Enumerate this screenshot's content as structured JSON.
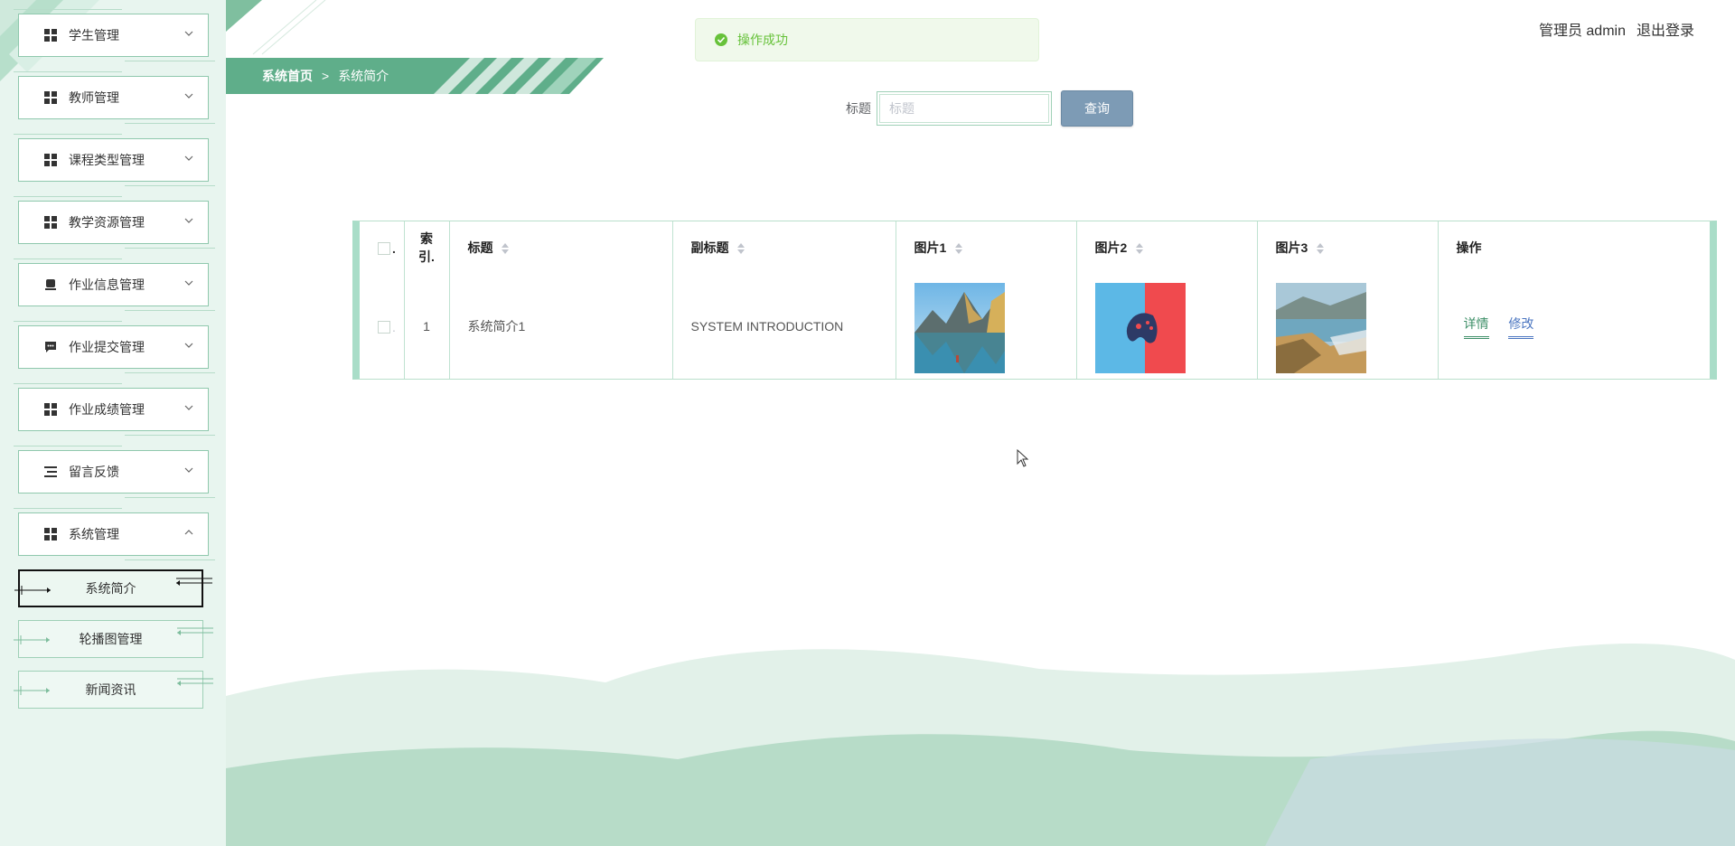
{
  "sidebar": {
    "menus": [
      {
        "label": "学生管理",
        "icon": "grid-icon",
        "expanded": false
      },
      {
        "label": "教师管理",
        "icon": "grid-icon",
        "expanded": false
      },
      {
        "label": "课程类型管理",
        "icon": "grid-icon",
        "expanded": false
      },
      {
        "label": "教学资源管理",
        "icon": "grid-icon",
        "expanded": false
      },
      {
        "label": "作业信息管理",
        "icon": "cup-icon",
        "expanded": false
      },
      {
        "label": "作业提交管理",
        "icon": "chat-icon",
        "expanded": false
      },
      {
        "label": "作业成绩管理",
        "icon": "grid-icon",
        "expanded": false
      },
      {
        "label": "留言反馈",
        "icon": "list-icon",
        "expanded": false
      },
      {
        "label": "系统管理",
        "icon": "grid-icon",
        "expanded": true
      }
    ],
    "submenu": [
      {
        "label": "系统简介",
        "active": true
      },
      {
        "label": "轮播图管理",
        "active": false
      },
      {
        "label": "新闻资讯",
        "active": false
      }
    ]
  },
  "breadcrumb": {
    "home": "系统首页",
    "separator": ">",
    "current": "系统简介"
  },
  "toast": {
    "text": "操作成功",
    "type": "success"
  },
  "user": {
    "role": "管理员 admin",
    "logout": "退出登录"
  },
  "search": {
    "label": "标题",
    "placeholder": "标题",
    "value": "",
    "button": "查询"
  },
  "table": {
    "headers": {
      "check": ".",
      "index": "索引.",
      "title": "标题",
      "subtitle": "副标题",
      "img1": "图片1",
      "img2": "图片2",
      "img3": "图片3",
      "ops": "操作"
    },
    "rows": [
      {
        "check": ".",
        "index": "1",
        "title": "系统简介1",
        "subtitle": "SYSTEM INTRODUCTION",
        "img1": "lake-mountain-image",
        "img2": "gamepad-image",
        "img3": "coast-image",
        "detail": "详情",
        "edit": "修改"
      }
    ]
  },
  "colors": {
    "sidebar_bg": "#e8f5ef",
    "accent_green": "#5fae8a",
    "button_blue": "#7d9bb5",
    "success": "#67c23a"
  }
}
